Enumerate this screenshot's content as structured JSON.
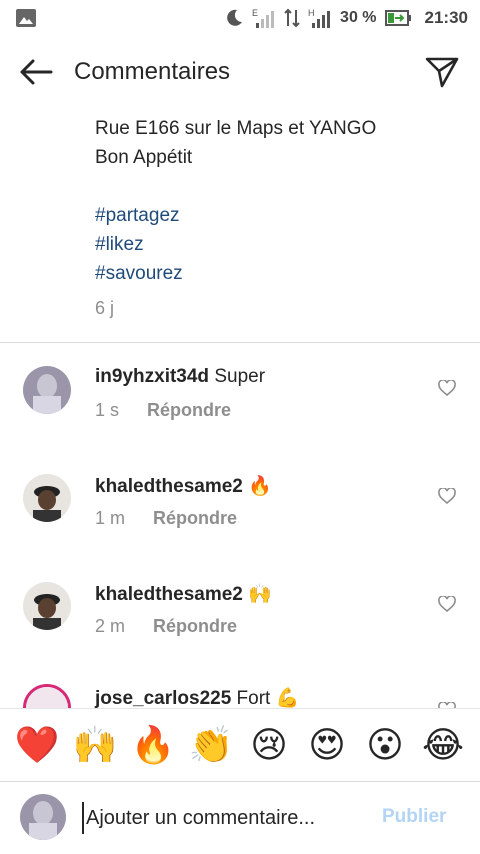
{
  "status_bar": {
    "battery_percent": "30 %",
    "time": "21:30",
    "network_label": "E",
    "network_label_2": "H"
  },
  "header": {
    "title": "Commentaires"
  },
  "caption": {
    "lines": [
      "Rue E166 sur le Maps et YANGO",
      "Bon Appétit"
    ],
    "hashtags": [
      "#partagez",
      "#likez",
      "#savourez"
    ],
    "time": "6 j"
  },
  "comments": [
    {
      "username": "in9yhzxit34d",
      "text": "Super",
      "time": "1 s",
      "reply": "Répondre"
    },
    {
      "username": "khaledthesame2",
      "text": "🔥",
      "time": "1 m",
      "reply": "Répondre"
    },
    {
      "username": "khaledthesame2",
      "text": "🙌",
      "time": "2 m",
      "reply": "Répondre"
    },
    {
      "username": "jose_carlos225",
      "text": "Fort 💪",
      "time": "",
      "reply": ""
    }
  ],
  "emoji_bar": [
    "❤️",
    "🙌",
    "🔥",
    "👏",
    "😢",
    "😍",
    "😮",
    "😂"
  ],
  "input": {
    "placeholder": "Ajouter un commentaire...",
    "publish_label": "Publier"
  },
  "colors": {
    "hashtag": "#1f4a7a",
    "publish_disabled": "#b3d4f5",
    "muted": "#8e8e8e"
  }
}
